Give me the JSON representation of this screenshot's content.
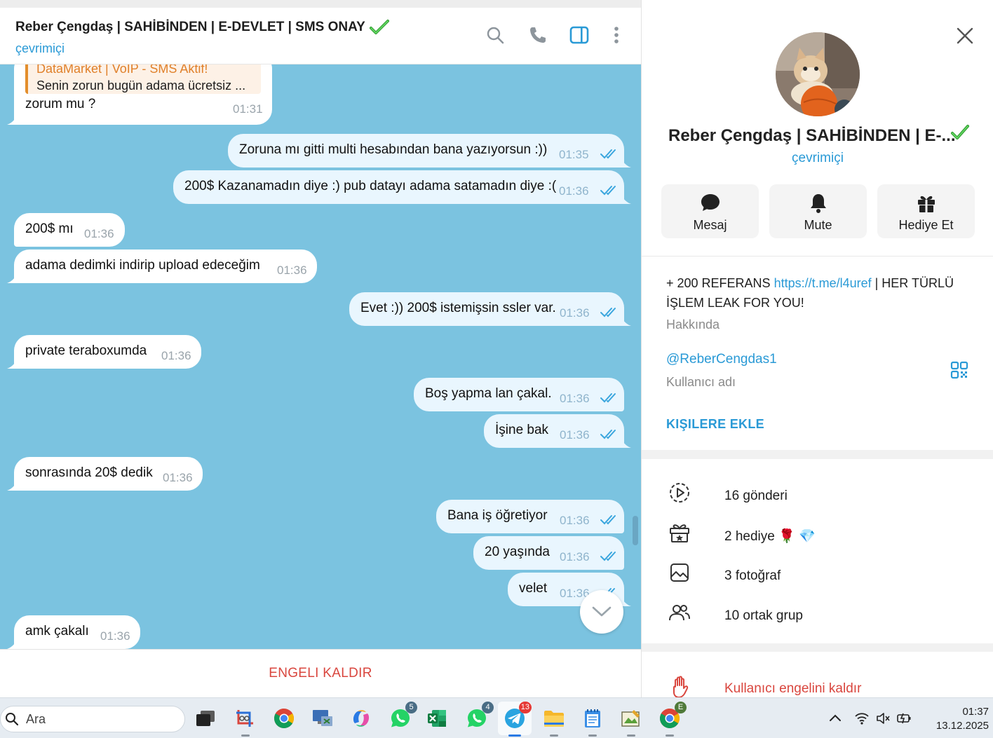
{
  "chat": {
    "title": "Reber Çengdaş | SAHİBİNDEN | E-DEVLET | SMS ONAY",
    "status": "çevrimiçi",
    "reply_quote": {
      "name": "DataMarket | VoIP - SMS Aktif!",
      "text": "Senin zorun bugün adama ücretsiz ..."
    },
    "messages": [
      {
        "dir": "in",
        "text": "zorum mu ?",
        "time": "01:31"
      },
      {
        "dir": "out",
        "text": "Zoruna mı gitti multi hesabından bana yazıyorsun :))",
        "time": "01:35"
      },
      {
        "dir": "out",
        "text": "200$ Kazanamadın diye :) pub datayı adama satamadın diye :(",
        "time": "01:36"
      },
      {
        "dir": "in",
        "text": "200$ mı",
        "time": "01:36"
      },
      {
        "dir": "in",
        "text": "adama dedimki indirip upload edeceğim",
        "time": "01:36"
      },
      {
        "dir": "out",
        "text": "Evet :)) 200$ istemişsin ssler var.",
        "time": "01:36"
      },
      {
        "dir": "in",
        "text": "private teraboxumda",
        "time": "01:36"
      },
      {
        "dir": "out",
        "text": "Boş yapma lan çakal.",
        "time": "01:36"
      },
      {
        "dir": "out",
        "text": "İşine bak",
        "time": "01:36"
      },
      {
        "dir": "in",
        "text": "sonrasında 20$ dedik",
        "time": "01:36"
      },
      {
        "dir": "out",
        "text": "Bana iş öğretiyor",
        "time": "01:36"
      },
      {
        "dir": "out",
        "text": "20 yaşında",
        "time": "01:36"
      },
      {
        "dir": "out",
        "text": "velet",
        "time": "01:36"
      },
      {
        "dir": "in",
        "text": "amk çakalı",
        "time": "01:36"
      }
    ],
    "unblock_label": "ENGELI KALDIR"
  },
  "header_icons": [
    "search-icon",
    "phone-icon",
    "sidebar-toggle-icon",
    "more-icon"
  ],
  "profile": {
    "name": "Reber Çengdaş | SAHİBİNDEN | E-...",
    "status": "çevrimiçi",
    "actions": [
      {
        "label": "Mesaj",
        "icon": "message-icon"
      },
      {
        "label": "Mute",
        "icon": "bell-icon"
      },
      {
        "label": "Hediye Et",
        "icon": "gift-icon"
      }
    ],
    "bio_prefix": "+ 200 REFERANS ",
    "bio_link": "https://t.me/l4uref",
    "bio_suffix": " | HER TÜRLÜ İŞLEM LEAK FOR YOU!",
    "bio_label": "Hakkında",
    "username": "@ReberCengdas1",
    "username_label": "Kullanıcı adı",
    "add_contact": "KIŞILERE EKLE",
    "media": [
      {
        "label": "16 gönderi",
        "icon": "stories-icon"
      },
      {
        "label": "2 hediye",
        "icon": "gift-icon"
      },
      {
        "label": "3 fotoğraf",
        "icon": "photo-icon"
      },
      {
        "label": "10 ortak grup",
        "icon": "groups-icon"
      }
    ],
    "unblock_user": "Kullanıcı engelini kaldır"
  },
  "taskbar": {
    "search_placeholder": "Ara",
    "badges": {
      "whatsapp1": "5",
      "whatsapp2": "4",
      "telegram": "13",
      "chrome_profile": "E"
    },
    "time": "01:37",
    "date": "13.12.2025"
  },
  "colors": {
    "accent": "#2a9ad6",
    "chat_bg": "#7bc3e0",
    "danger": "#d9463e",
    "verified": "#3ba83b"
  }
}
